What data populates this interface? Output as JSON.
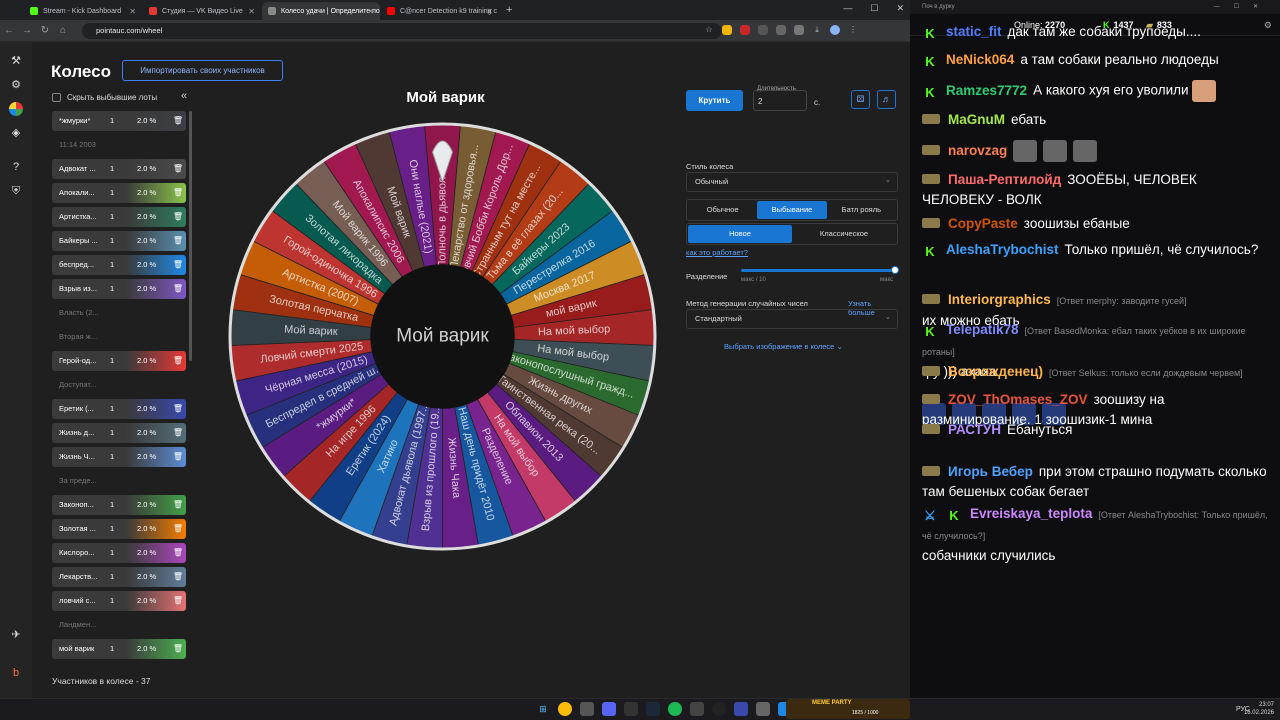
{
  "browser": {
    "tabs": [
      {
        "label": "Stream - Kick Dashboard",
        "color": "#53fc18"
      },
      {
        "label": "Студия — VK Видео Live",
        "color": "#e53935"
      },
      {
        "label": "Колесо удачи | Определите по",
        "color": "#888888"
      },
      {
        "label": "C@ncer Detection k9 training c",
        "color": "#ff0000"
      }
    ],
    "new_tab": "+",
    "url": "pointauc.com/wheel"
  },
  "app": {
    "title": "Колесо",
    "import_button": "Импортировать своих участников",
    "hide_label": "Скрыть выбывшие лоты",
    "collapse": "«",
    "participants_count": "Участников в колесе - 37",
    "lots": [
      {
        "name": "*жмурки*",
        "amount": "1",
        "percent": "2.0 %",
        "color": "#3b3e44",
        "out": false
      },
      {
        "name": "11:14 2003",
        "amount": "",
        "percent": "",
        "color": "",
        "out": true
      },
      {
        "name": "Адвокат ...",
        "amount": "1",
        "percent": "2.0 %",
        "color": "#4a4a4a",
        "out": false
      },
      {
        "name": "Апокали...",
        "amount": "1",
        "percent": "2.0 %",
        "color": "#8bc34a",
        "out": false
      },
      {
        "name": "Артистка...",
        "amount": "1",
        "percent": "2.0 %",
        "color": "#2e7d5b",
        "out": false
      },
      {
        "name": "Байкеры ...",
        "amount": "1",
        "percent": "2.0 %",
        "color": "#5a8fb0",
        "out": false
      },
      {
        "name": "беспред...",
        "amount": "1",
        "percent": "2.0 %",
        "color": "#1e88e5",
        "out": false
      },
      {
        "name": "Взрыв из...",
        "amount": "1",
        "percent": "2.0 %",
        "color": "#7e57c2",
        "out": false
      },
      {
        "name": "Власть (2...",
        "amount": "",
        "percent": "",
        "color": "",
        "out": true
      },
      {
        "name": "Вторая ж...",
        "amount": "",
        "percent": "",
        "color": "",
        "out": true
      },
      {
        "name": "Герой-од...",
        "amount": "1",
        "percent": "2.0 %",
        "color": "#e53935",
        "out": false
      },
      {
        "name": "Доступат...",
        "amount": "",
        "percent": "",
        "color": "",
        "out": true
      },
      {
        "name": "Еретик (...",
        "amount": "1",
        "percent": "2.0 %",
        "color": "#3949ab",
        "out": false
      },
      {
        "name": "Жизнь д...",
        "amount": "1",
        "percent": "2.0 %",
        "color": "#546e7a",
        "out": false
      },
      {
        "name": "Жизнь Ч...",
        "amount": "1",
        "percent": "2.0 %",
        "color": "#5c8ed6",
        "out": false
      },
      {
        "name": "За преде...",
        "amount": "",
        "percent": "",
        "color": "",
        "out": true
      },
      {
        "name": "Законоп...",
        "amount": "1",
        "percent": "2.0 %",
        "color": "#43a047",
        "out": false
      },
      {
        "name": "Золотая ...",
        "amount": "1",
        "percent": "2.0 %",
        "color": "#f57c00",
        "out": false
      },
      {
        "name": "Кислоро...",
        "amount": "1",
        "percent": "2.0 %",
        "color": "#ab47bc",
        "out": false
      },
      {
        "name": "Лекарств...",
        "amount": "1",
        "percent": "2.0 %",
        "color": "#607d9b",
        "out": false
      },
      {
        "name": "ловчий с...",
        "amount": "1",
        "percent": "2.0 %",
        "color": "#e57373",
        "out": false
      },
      {
        "name": "Ландмен...",
        "amount": "",
        "percent": "",
        "color": "",
        "out": true
      },
      {
        "name": "мой варик",
        "amount": "1",
        "percent": "2.0 %",
        "color": "#4caf50",
        "out": false
      }
    ]
  },
  "wheel": {
    "winner_title": "Мой варик",
    "center_label": "Мой варик",
    "segments": [
      {
        "label": "Полночь в дьяволом (2...",
        "color": "#ad1457"
      },
      {
        "label": "Лекарство от здоровья...",
        "color": "#8e6d3a"
      },
      {
        "label": "Ловчий Бобби Король Дор...",
        "color": "#c2185b"
      },
      {
        "label": "Странным тут на месте...",
        "color": "#bf360c"
      },
      {
        "label": "Тьма в её глазах (20...",
        "color": "#d84315"
      },
      {
        "label": "Байкеры 2023",
        "color": "#00796b"
      },
      {
        "label": "Перестрелка 2016",
        "color": "#0277bd"
      },
      {
        "label": "Москва 2017",
        "color": "#f9a825"
      },
      {
        "label": "мой варик",
        "color": "#b71c1c"
      },
      {
        "label": "На мой выбор",
        "color": "#c62828"
      },
      {
        "label": "На мой выбор",
        "color": "#455a64"
      },
      {
        "label": "Законопослушный гражд...",
        "color": "#2e7d32"
      },
      {
        "label": "Жизнь других",
        "color": "#795548"
      },
      {
        "label": "Таинственная река (20...",
        "color": "#5d4037"
      },
      {
        "label": "Облавион 2013",
        "color": "#6a1b9a"
      },
      {
        "label": "На мой выбор",
        "color": "#ec407a"
      },
      {
        "label": "Разделение",
        "color": "#8e24aa"
      },
      {
        "label": "Наш день придёт 2010",
        "color": "#1565c0"
      },
      {
        "label": "Жизнь Чака",
        "color": "#7b1fa2"
      },
      {
        "label": "Взрыв из прошлого (19...",
        "color": "#5e35b1"
      },
      {
        "label": "Адвокат дьявола (1997...",
        "color": "#3949ab"
      },
      {
        "label": "Хатико",
        "color": "#1e88e5"
      },
      {
        "label": "Еретик (2024)",
        "color": "#0d47a1"
      },
      {
        "label": "На игре 1996",
        "color": "#c62828"
      },
      {
        "label": "*жмурки*",
        "color": "#6a1b9a"
      },
      {
        "label": "Беспредел в средней ш...",
        "color": "#283593"
      },
      {
        "label": "Чёрная месса (2015)",
        "color": "#4527a0"
      },
      {
        "label": "Ловчий смерти 2025",
        "color": "#d32f2f"
      },
      {
        "label": "Мой варик",
        "color": "#37474f"
      },
      {
        "label": "Золотая перчатка",
        "color": "#bf360c"
      },
      {
        "label": "Артистка (2007)",
        "color": "#ef6c00"
      },
      {
        "label": "Горой-одиночка 1996",
        "color": "#e53935"
      },
      {
        "label": "Золотая лихорадка",
        "color": "#00695c"
      },
      {
        "label": "Мой варик 1996",
        "color": "#8d6e63"
      },
      {
        "label": "Апокалипсис 2006",
        "color": "#c2185b"
      },
      {
        "label": "Мой варик",
        "color": "#5d4037"
      },
      {
        "label": "Они наглые (2021)",
        "color": "#7b1fa2"
      }
    ]
  },
  "controls": {
    "spin_button": "Крутить",
    "duration_label": "Длительность",
    "duration_value": "2",
    "seconds": "с.",
    "wheel_style_label": "Стиль колеса",
    "wheel_style_value": "Обычный",
    "mode_tabs": [
      "Обычное",
      "Выбывание",
      "Батл рояль"
    ],
    "submode_tabs": [
      "Новое",
      "Классическое"
    ],
    "how_link": "как это работает?",
    "split_label": "Разделение",
    "split_min": "макс / 10",
    "split_max": "макс",
    "split_value_fraction": 1.0,
    "rng_label": "Метод генерации случайных чисел",
    "rng_more": "Узнать больше",
    "rng_value": "Стандартный",
    "image_button": "Выбрать изображение в колесе"
  },
  "chat": {
    "header": "Поч в дурку",
    "online_label": "Online:",
    "online_count": "2270",
    "stat1": "1437",
    "stat2": "833",
    "messages": [
      {
        "user": "static_fit",
        "color": "#4f7fff",
        "badge": "k",
        "text": "дак там же собаки трупоеды...."
      },
      {
        "user": "NeNick064",
        "color": "#ff9f43",
        "badge": "k",
        "text": "а там собаки реально людоеды"
      },
      {
        "user": "Ramzes7772",
        "color": "#2ecc71",
        "badge": "k",
        "text": "А какого хуя его уволили"
      },
      {
        "user": "MaGnuM",
        "color": "#a4e84c",
        "badge": "g",
        "text": "ебать"
      },
      {
        "user": "narovzag",
        "color": "#ff7f50",
        "badge": "g",
        "text": ""
      },
      {
        "user": "Паша-Рептилойд",
        "color": "#ff6b6b",
        "badge": "g",
        "text": "ЗООЁБЫ, ЧЕЛОВЕК ЧЕЛОВЕКУ - ВОЛК"
      },
      {
        "user": "CopyPaste",
        "color": "#d35400",
        "badge": "g",
        "text": "зоошизы ебаные"
      },
      {
        "user": "AleshaTrybochist",
        "color": "#3ba3ff",
        "badge": "k",
        "text": "Только пришёл, чё случилось?"
      },
      {
        "user": "Interiorgraphics",
        "color": "#ffb84d",
        "badge": "g",
        "reply": "[Ответ merphy: заводите гусей]",
        "text": "их можно ебать"
      },
      {
        "user": "Telepatik78",
        "color": "#7f8cff",
        "badge": "k",
        "reply": "[Ответ BasedMonka: ебал таких уебков в их широкие ротаны]",
        "text": "фу ))) ахаха"
      },
      {
        "user": "Возрожденец)",
        "color": "#ffb347",
        "badge": "g",
        "reply": "[Ответ Selkus: только если дождевым червем]",
        "text": ""
      },
      {
        "user": "ZOV_ThOmases_ZOV",
        "color": "#e8553a",
        "badge": "g",
        "text": "зоошизу на разминирование. 1 зоошизик-1 мина"
      },
      {
        "user": "РАСТУН",
        "color": "#b08cff",
        "badge": "g",
        "text": "Ебануться"
      },
      {
        "user": "Игорь Вебер",
        "color": "#4fa3ff",
        "badge": "g",
        "text": "при этом страшно подумать сколько там бешеных собак бегает"
      },
      {
        "user": "Evreiskaya_teplota",
        "color": "#cc88ff",
        "badge": "bk",
        "reply": "[Ответ AleshaTrybochist: Только пришёл, чё случилось?]",
        "text": "собачники случились"
      }
    ]
  },
  "taskbar": {
    "meme_party": "MEME PARTY",
    "meme_score": "1825 / 1000",
    "lang": "РУС",
    "time": "23:07",
    "date": "16.02.2026"
  }
}
